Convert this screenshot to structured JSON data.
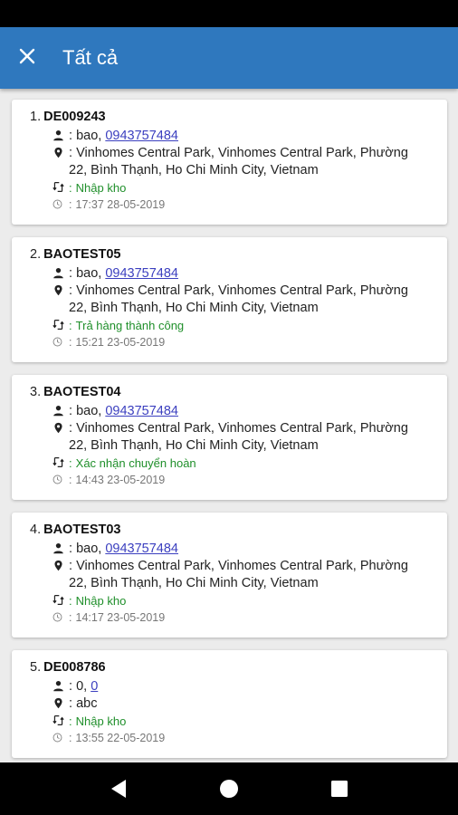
{
  "header": {
    "title": "Tất cả"
  },
  "orders": [
    {
      "index": "1.",
      "code": "DE009243",
      "name": "bao,",
      "phone": "0943757484",
      "address_line1": "Vinhomes Central Park, Vinhomes Central Park, Phường",
      "address_line2": "22, Bình Thạnh, Ho Chi Minh City, Vietnam",
      "status": "Nhập kho",
      "time": "17:37 28-05-2019"
    },
    {
      "index": "2.",
      "code": "BAOTEST05",
      "name": "bao,",
      "phone": "0943757484",
      "address_line1": "Vinhomes Central Park, Vinhomes Central Park, Phường",
      "address_line2": "22, Bình Thạnh, Ho Chi Minh City, Vietnam",
      "status": "Trả hàng thành công",
      "time": "15:21 23-05-2019"
    },
    {
      "index": "3.",
      "code": "BAOTEST04",
      "name": "bao,",
      "phone": "0943757484",
      "address_line1": "Vinhomes Central Park, Vinhomes Central Park, Phường",
      "address_line2": "22, Bình Thạnh, Ho Chi Minh City, Vietnam",
      "status": "Xác nhận chuyển hoàn",
      "time": "14:43 23-05-2019"
    },
    {
      "index": "4.",
      "code": "BAOTEST03",
      "name": "bao,",
      "phone": "0943757484",
      "address_line1": "Vinhomes Central Park, Vinhomes Central Park, Phường",
      "address_line2": "22, Bình Thạnh, Ho Chi Minh City, Vietnam",
      "status": "Nhập kho",
      "time": "14:17 23-05-2019"
    },
    {
      "index": "5.",
      "code": "DE008786",
      "name": "0,",
      "phone": "0",
      "address_line1": "abc",
      "address_line2": "",
      "status": "Nhập kho",
      "time": "13:55 22-05-2019"
    }
  ],
  "field_separator": ":",
  "icons": {
    "close": "close-icon",
    "person": "person-icon",
    "location": "location-pin-icon",
    "status": "swap-icon",
    "time": "clock-icon",
    "back": "back-triangle-icon",
    "home": "home-circle-icon",
    "recents": "recents-square-icon"
  },
  "colors": {
    "app_bar": "#2f78be",
    "status_text": "#1f8f2a",
    "phone_link": "#3b3fbf",
    "background": "#ececec"
  }
}
